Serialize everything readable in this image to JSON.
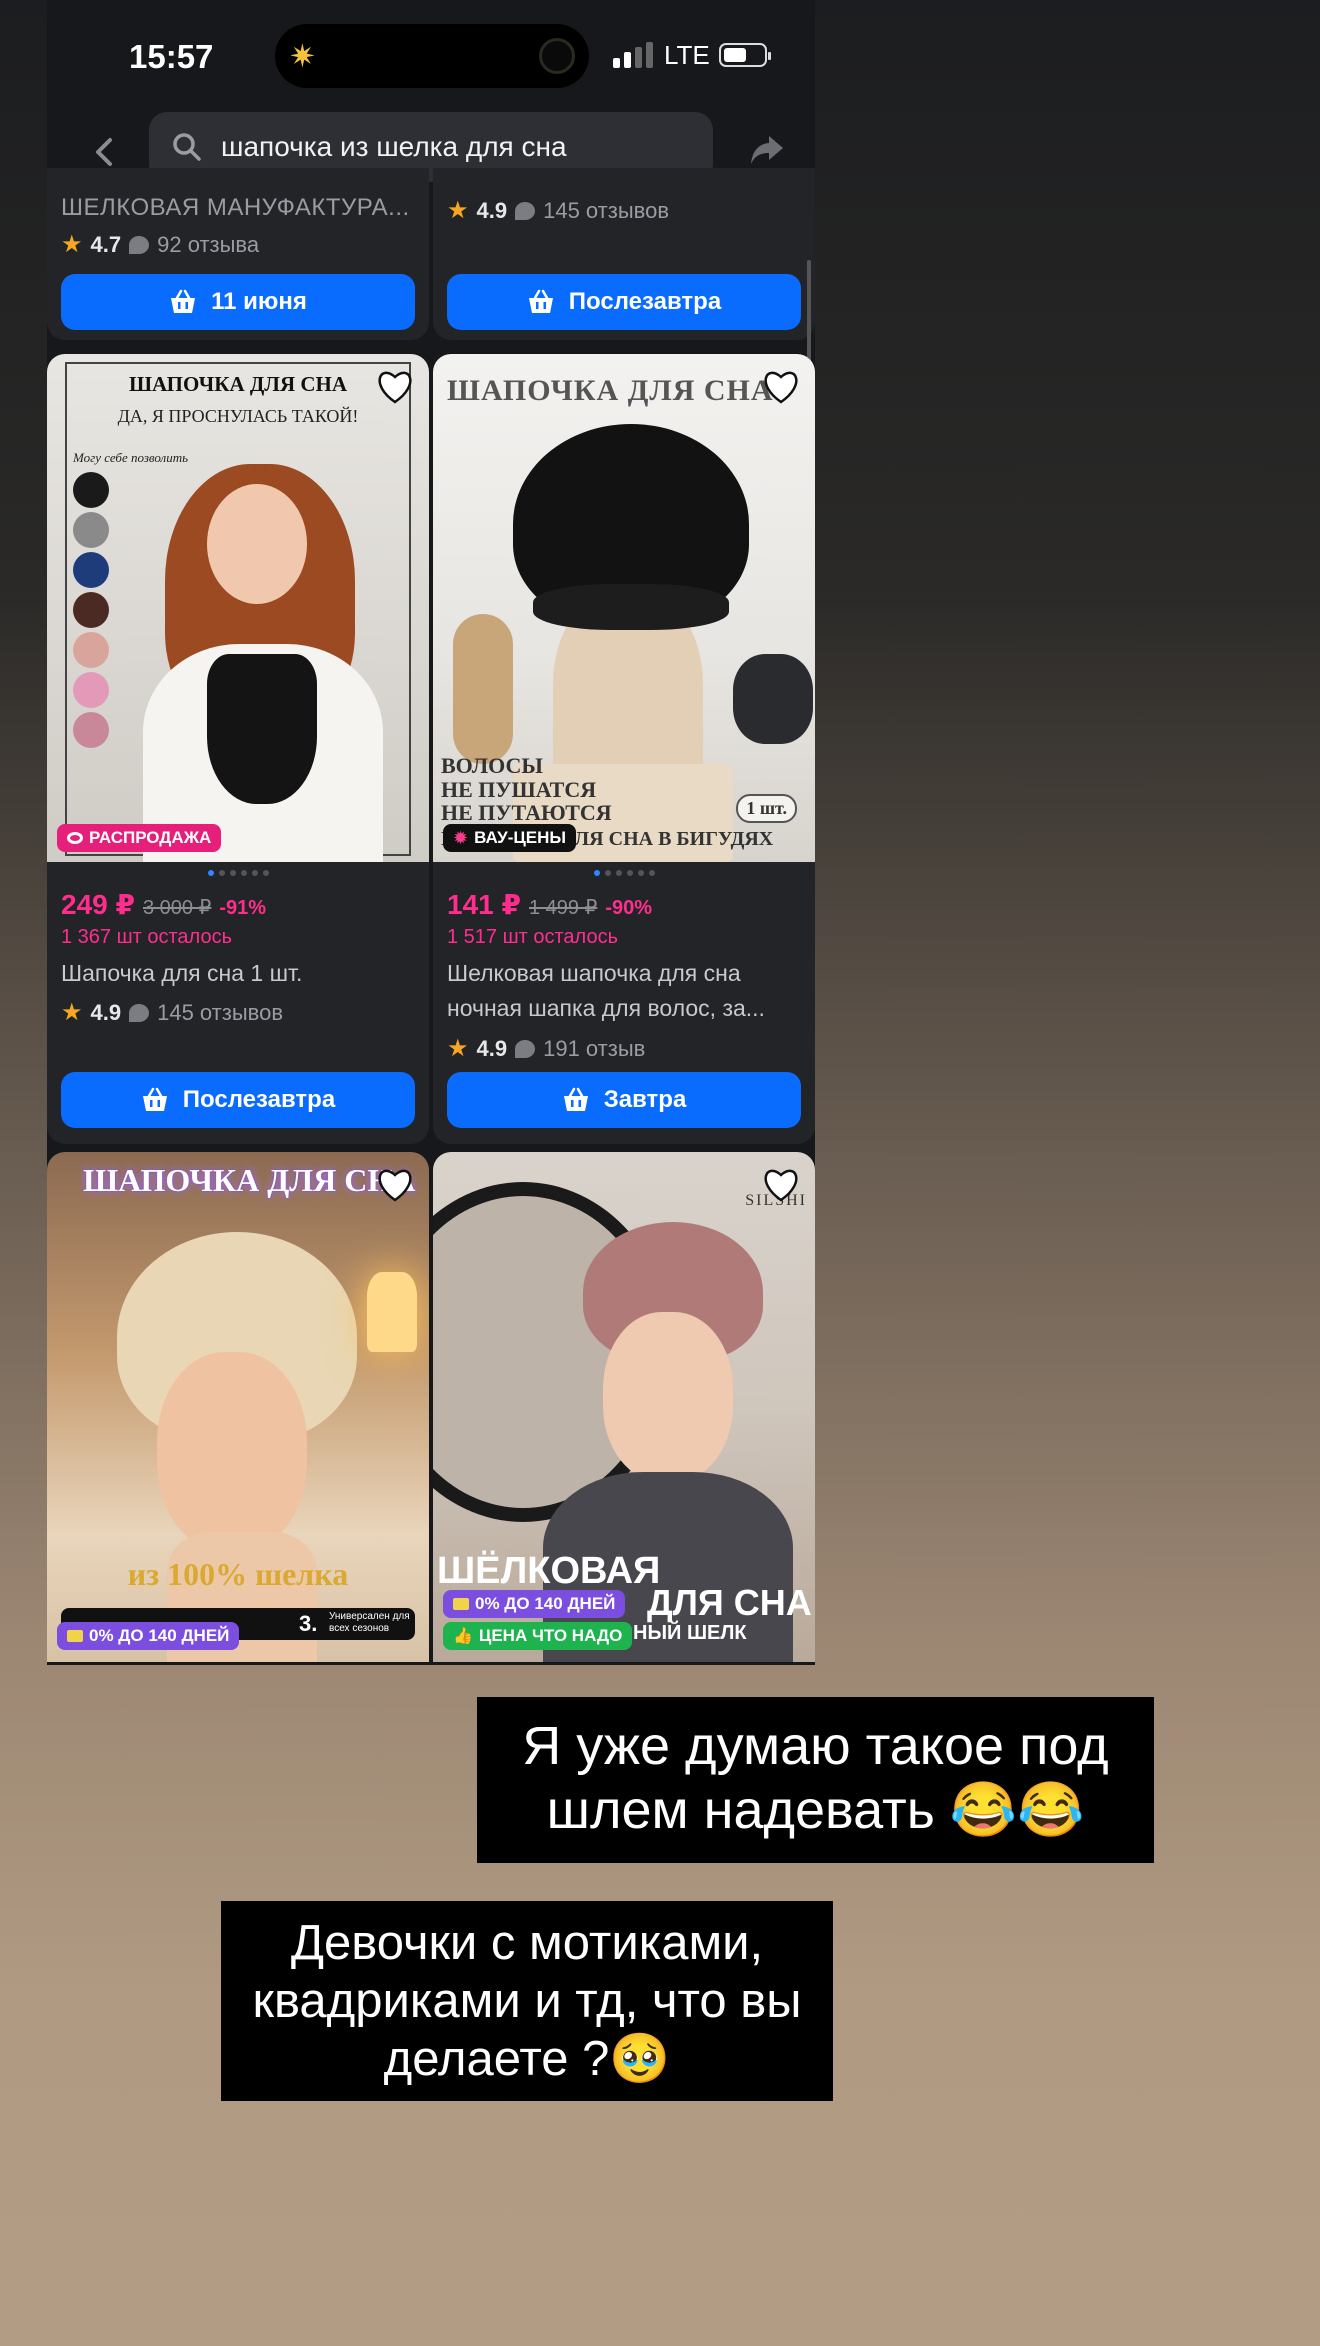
{
  "status_bar": {
    "time": "15:57",
    "network": "LTE"
  },
  "search": {
    "query": "шапочка из шелка для сна"
  },
  "top_row": [
    {
      "seller": "ШЕЛКОВАЯ МАНУФАКТУРА...",
      "rating": "4.7",
      "reviews": "92 отзыва",
      "button": "11 июня"
    },
    {
      "rating": "4.9",
      "reviews": "145 отзывов",
      "button": "Послезавтра"
    }
  ],
  "products": [
    {
      "image_heading": "ШАПОЧКА ДЛЯ СНА",
      "image_subheading": "ДА, Я ПРОСНУЛАСЬ ТАКОЙ!",
      "image_note": "Могу себе позволить",
      "tag": "РАСПРОДАЖА",
      "price": "249 ₽",
      "old_price": "3 000 ₽",
      "discount": "-91%",
      "stock": "1 367 шт осталось",
      "title": "Шапочка для сна 1 шт.",
      "rating": "4.9",
      "reviews": "145 отзывов",
      "button": "Послезавтра"
    },
    {
      "image_heading": "ШАПОЧКА ДЛЯ СНА",
      "image_overlay_1": "ВОЛОСЫ",
      "image_overlay_2": "НЕ ПУШАТСЯ",
      "image_overlay_3": "НЕ ПУТАЮТСЯ",
      "image_overlay_4": "ПОДХОДИТ ДЛЯ СНА В БИГУДЯХ",
      "image_badge": "1 шт.",
      "tag": "ВАУ-ЦЕНЫ",
      "price": "141 ₽",
      "old_price": "1 499 ₽",
      "discount": "-90%",
      "stock": "1 517 шт осталось",
      "title": "Шелковая шапочка для сна ночная шапка для волос, за...",
      "rating": "4.9",
      "reviews": "191 отзыв",
      "button": "Завтра"
    }
  ],
  "bottom_row": [
    {
      "image_heading": "ШАПОЧКА ДЛЯ СНА",
      "image_footer": "из 100% шелка",
      "feature_3_num": "3.",
      "feature_3_text": "Универсален для всех сезонов",
      "tag": "0% ДО 140 ДНЕЙ"
    },
    {
      "brand": "SILSHI",
      "image_heading": "ШЁЛКОВАЯ",
      "image_heading_2": "ДЛЯ СНА",
      "image_heading_3": "НЫЙ ШЕЛК",
      "tag_1": "0% ДО 140 ДНЕЙ",
      "tag_2": "ЦЕНА ЧТО НАДО"
    }
  ],
  "captions": {
    "first": "Я уже думаю такое под шлем надевать 😂😂",
    "second": "Девочки с мотиками, квадриками и тд, что вы делаете ?🥹"
  },
  "colors": {
    "accent": "#0a6cff",
    "sale": "#ff2e8e",
    "star": "#f6a623"
  }
}
